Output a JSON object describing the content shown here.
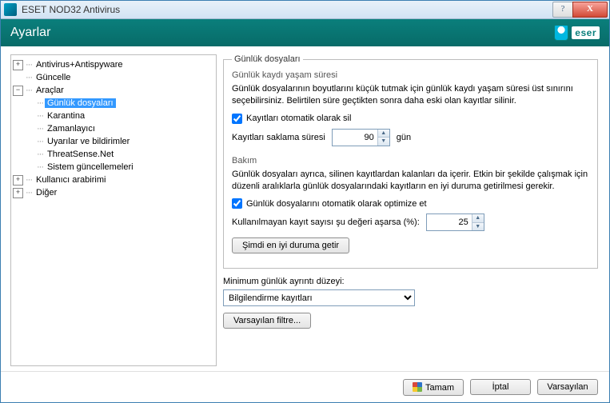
{
  "window": {
    "title": "ESET NOD32 Antivirus",
    "help": "?",
    "close": "X"
  },
  "header": {
    "caption": "Ayarlar",
    "brand": "eser"
  },
  "tree": {
    "n0": {
      "label": "Antivirus+Antispyware",
      "tog": "+"
    },
    "n1": {
      "label": "Güncelle"
    },
    "n2": {
      "label": "Araçlar",
      "tog": "−"
    },
    "n2c": {
      "c0": "Günlük dosyaları",
      "c1": "Karantina",
      "c2": "Zamanlayıcı",
      "c3": "Uyarılar ve bildirimler",
      "c4": "ThreatSense.Net",
      "c5": "Sistem güncellemeleri"
    },
    "n3": {
      "label": "Kullanıcı arabirimi",
      "tog": "+"
    },
    "n4": {
      "label": "Diğer",
      "tog": "+"
    }
  },
  "pane": {
    "group1": {
      "legend": "Günlük dosyaları",
      "sub": "Günlük kaydı yaşam süresi",
      "desc": "Günlük dosyalarının boyutlarını küçük tutmak için günlük kaydı yaşam süresi üst sınırını seçebilirsiniz. Belirtilen süre geçtikten sonra daha eski olan kayıtlar silinir.",
      "cb1": "Kayıtları otomatik olarak sil",
      "row1_label": "Kayıtları saklama süresi",
      "row1_value": "90",
      "row1_unit": "gün",
      "sub2": "Bakım",
      "desc2": "Günlük dosyaları ayrıca, silinen kayıtlardan kalanları da içerir. Etkin bir şekilde çalışmak için düzenli aralıklarla günlük dosyalarındaki kayıtların en iyi duruma getirilmesi gerekir.",
      "cb2": "Günlük dosyalarını otomatik olarak optimize et",
      "row2_label": "Kullanılmayan kayıt sayısı şu değeri aşarsa (%):",
      "row2_value": "25",
      "btn_opt": "Şimdi en iyi duruma getir"
    },
    "detail_label": "Minimum günlük ayrıntı düzeyi:",
    "detail_value": "Bilgilendirme kayıtları",
    "btn_filter": "Varsayılan filtre..."
  },
  "footer": {
    "ok": "Tamam",
    "cancel": "İptal",
    "defaults": "Varsayılan"
  }
}
